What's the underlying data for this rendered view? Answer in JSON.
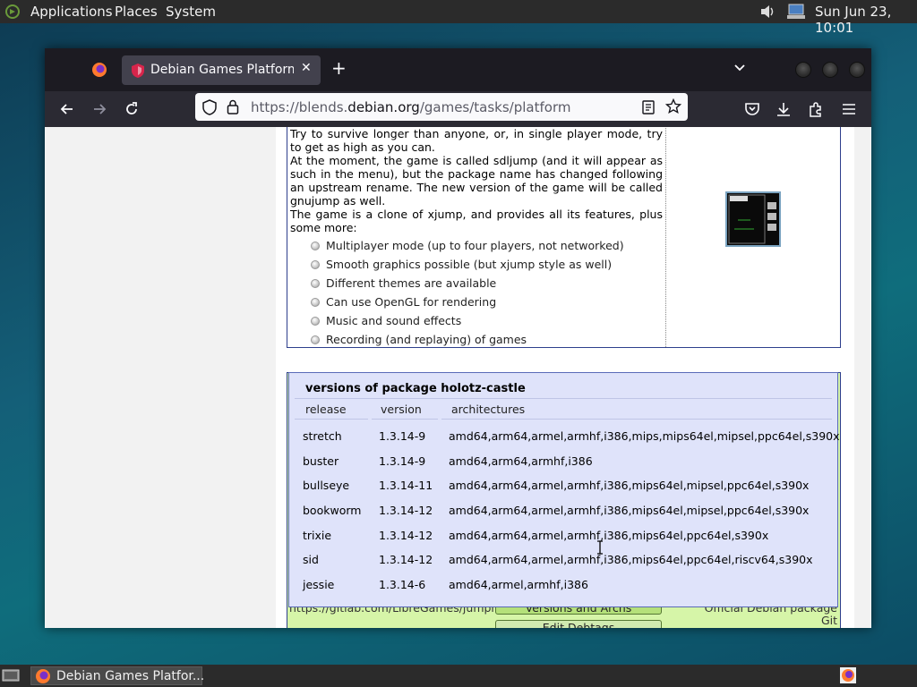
{
  "top_panel": {
    "menus": [
      "Applications",
      "Places",
      "System"
    ],
    "clock": "Sun Jun 23, 10:01"
  },
  "browser": {
    "tab_title": "Debian Games Platform p",
    "tab_close": "✕",
    "new_tab": "+",
    "url": {
      "prefix": "https://blends.",
      "domain": "debian.org",
      "path": "/games/tasks/platform"
    }
  },
  "description": {
    "paragraphs": [
      "Try to survive longer than anyone, or, in single player mode, try to get as high as you can.",
      "At the moment, the game is called sdljump (and it will appear as such in the menu), but the package name has changed following an upstream rename. The new version of the game will be called gnujump as well.",
      "The game is a clone of xjump, and provides all its features, plus some more:"
    ],
    "features": [
      "Multiplayer mode (up to four players, not networked)",
      "Smooth graphics possible (but xjump style as well)",
      "Different themes are available",
      "Can use OpenGL for rendering",
      "Music and sound effects",
      "Recording (and replaying) of games"
    ]
  },
  "versions": {
    "title": "versions of package holotz-castle",
    "headers": [
      "release",
      "version",
      "architectures"
    ],
    "rows": [
      [
        "stretch",
        "1.3.14-9",
        "amd64,arm64,armel,armhf,i386,mips,mips64el,mipsel,ppc64el,s390x"
      ],
      [
        "buster",
        "1.3.14-9",
        "amd64,arm64,armhf,i386"
      ],
      [
        "bullseye",
        "1.3.14-11",
        "amd64,arm64,armel,armhf,i386,mips64el,mipsel,ppc64el,s390x"
      ],
      [
        "bookworm",
        "1.3.14-12",
        "amd64,arm64,armel,armhf,i386,mips64el,mipsel,ppc64el,s390x"
      ],
      [
        "trixie",
        "1.3.14-12",
        "amd64,arm64,armel,armhf,i386,mips64el,ppc64el,s390x"
      ],
      [
        "sid",
        "1.3.14-12",
        "amd64,arm64,armel,armhf,i386,mips64el,ppc64el,riscv64,s390x"
      ],
      [
        "jessie",
        "1.3.14-6",
        "amd64,armel,armhf,i386"
      ]
    ]
  },
  "links_box": {
    "homepage": "https://gitlab.com/LibreGames/jumpnbump/",
    "versions_button": "Versions and Archs",
    "debtags_button": "Edit Debtags",
    "official": "Official Debian package Git"
  },
  "taskbar": {
    "task_label": "Debian Games Platfor..."
  },
  "colors": {
    "popup_bg": "#dfe3fa",
    "links_bg": "#d6f5a8",
    "border_blue": "#2e3f8c"
  }
}
